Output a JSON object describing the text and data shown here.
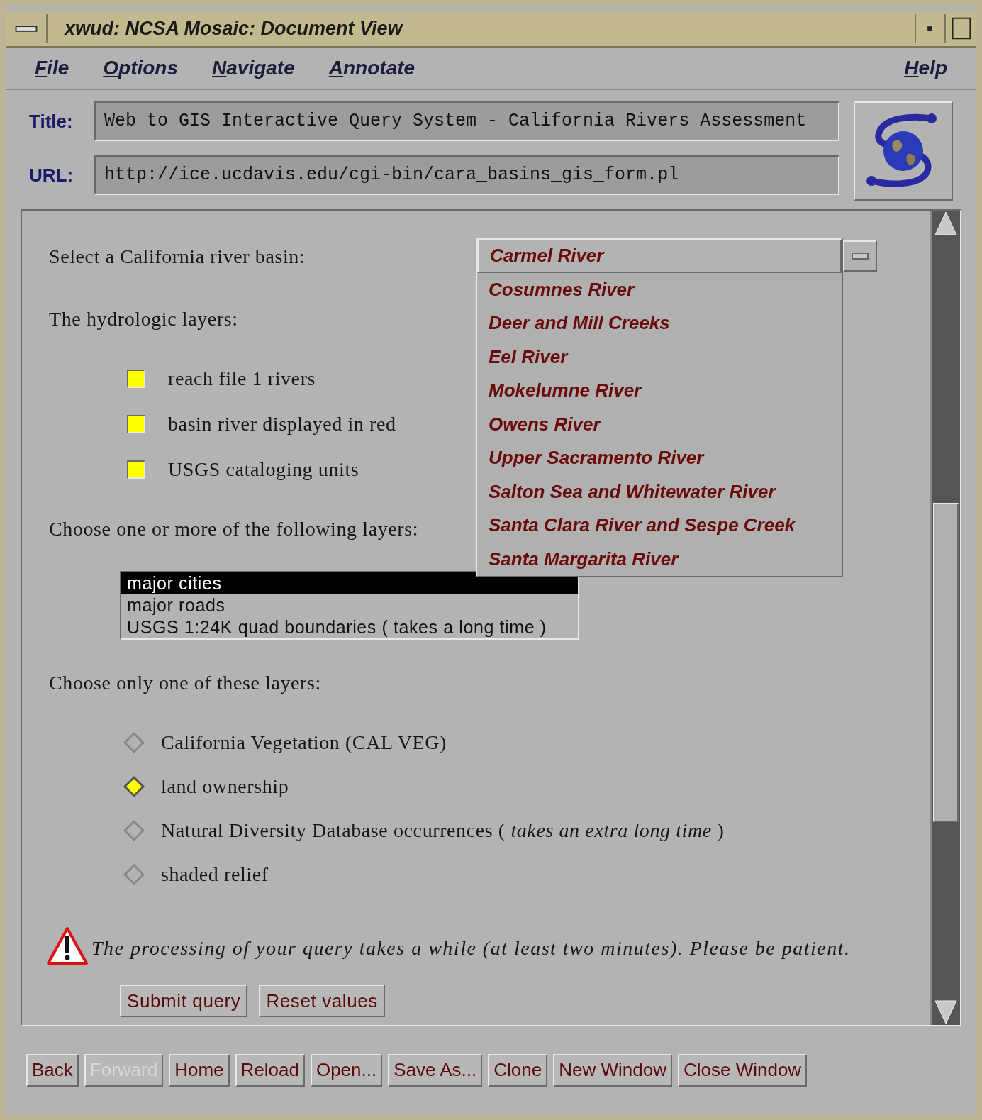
{
  "window": {
    "title": "xwud: NCSA Mosaic: Document View"
  },
  "menu": [
    "File",
    "Options",
    "Navigate",
    "Annotate"
  ],
  "help_menu": "Help",
  "title_field": {
    "label": "Title:",
    "value": "Web to GIS Interactive Query System - California Rivers Assessment"
  },
  "url_field": {
    "label": "URL:",
    "value": "http://ice.ucdavis.edu/cgi-bin/cara_basins_gis_form.pl"
  },
  "form": {
    "basin_label": "Select a California river basin:",
    "basin_dropdown": {
      "expanded": true,
      "options": [
        {
          "label": "Carmel River",
          "selected": true
        },
        {
          "label": "Cosumnes River",
          "selected": false
        },
        {
          "label": "Deer and Mill Creeks",
          "selected": false
        },
        {
          "label": "Eel River",
          "selected": false
        },
        {
          "label": "Mokelumne River",
          "selected": false
        },
        {
          "label": "Owens River",
          "selected": false
        },
        {
          "label": "Upper Sacramento River",
          "selected": false
        },
        {
          "label": "Salton Sea and Whitewater River",
          "selected": false
        },
        {
          "label": "Santa Clara River and Sespe Creek",
          "selected": false
        },
        {
          "label": "Santa Margarita River",
          "selected": false
        }
      ]
    },
    "hydrologic_label": "The hydrologic layers:",
    "hydrologic_layers": [
      {
        "label": "reach file 1 rivers",
        "checked": true
      },
      {
        "label": "basin river displayed in red",
        "checked": true
      },
      {
        "label": "USGS cataloging units",
        "checked": true
      }
    ],
    "layers_label": "Choose one or more of the following layers:",
    "layers_list": [
      {
        "label": "major cities",
        "selected": true
      },
      {
        "label": "major roads",
        "selected": false
      },
      {
        "label": "USGS 1:24K quad boundaries ( takes a long time )",
        "selected": false
      }
    ],
    "single_label": "Choose only one of these layers:",
    "single_layers": [
      {
        "label": "California Vegetation (CAL VEG)",
        "selected": false
      },
      {
        "label": "land ownership",
        "selected": true
      },
      {
        "label": "Natural Diversity Database occurrences ( *takes an extra long time* )",
        "selected": false
      },
      {
        "label": "shaded relief",
        "selected": false
      }
    ],
    "warning": "The processing of your query takes a while (at least two minutes). Please be patient.",
    "buttons": [
      "Submit query",
      "Reset values"
    ]
  },
  "nav_buttons": [
    {
      "label": "Back",
      "disabled": false
    },
    {
      "label": "Forward",
      "disabled": true
    },
    {
      "label": "Home",
      "disabled": false
    },
    {
      "label": "Reload",
      "disabled": false
    },
    {
      "label": "Open...",
      "disabled": false
    },
    {
      "label": "Save As...",
      "disabled": false
    },
    {
      "label": "Clone",
      "disabled": false
    },
    {
      "label": "New Window",
      "disabled": false
    },
    {
      "label": "Close Window",
      "disabled": false
    }
  ]
}
